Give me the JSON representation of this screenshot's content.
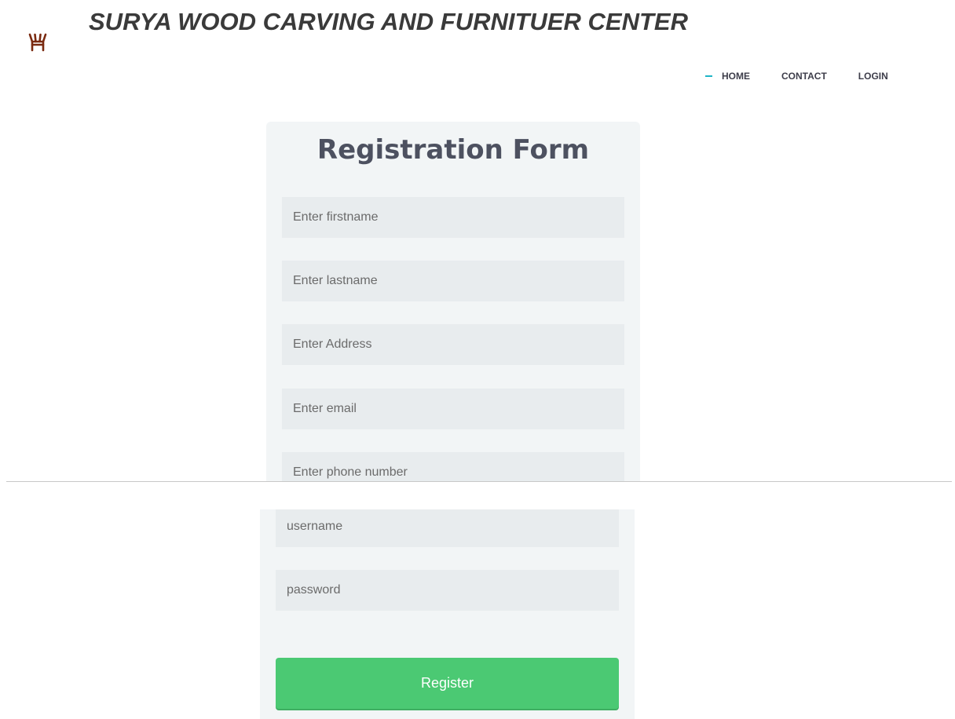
{
  "header": {
    "site_title": "SURYA WOOD CARVING AND FURNITUER CENTER",
    "logo_icon": "carved-chair-logo-icon",
    "logo_color": "#7a2a10"
  },
  "nav": {
    "items": [
      {
        "label": "HOME",
        "active": true
      },
      {
        "label": "CONTACT",
        "active": false
      },
      {
        "label": "LOGIN",
        "active": false
      }
    ],
    "active_marker_color": "#1fb5c7"
  },
  "form": {
    "title": "Registration Form",
    "fields": {
      "firstname": {
        "placeholder": "Enter firstname",
        "value": ""
      },
      "lastname": {
        "placeholder": "Enter lastname",
        "value": ""
      },
      "address": {
        "placeholder": "Enter Address",
        "value": ""
      },
      "email": {
        "placeholder": "Enter email",
        "value": ""
      },
      "phone": {
        "placeholder": "Enter phone number",
        "value": ""
      },
      "username": {
        "placeholder": "username",
        "value": ""
      },
      "password": {
        "placeholder": "password",
        "value": ""
      }
    },
    "submit_label": "Register",
    "submit_color": "#4bc973"
  }
}
